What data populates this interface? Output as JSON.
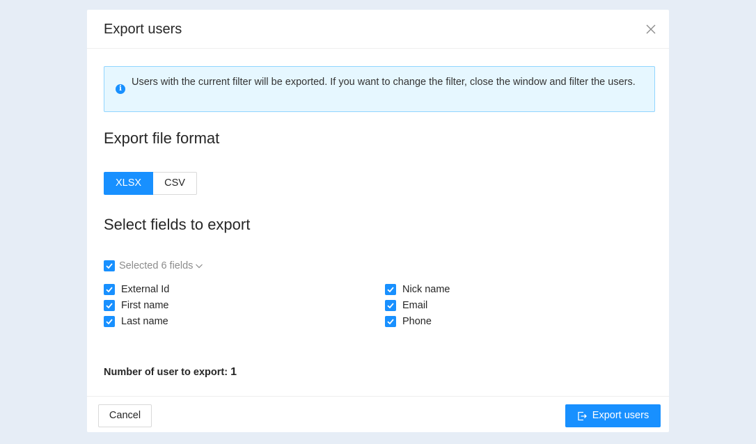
{
  "modal": {
    "title": "Export users",
    "info_text": "Users with the current filter will be exported. If you want to change the filter, close the window and filter the users.",
    "format_section_title": "Export file format",
    "formats": [
      "XLSX",
      "CSV"
    ],
    "selected_format": "XLSX",
    "fields_section_title": "Select fields to export",
    "select_all_label": "Selected 6 fields",
    "fields_left": [
      "External Id",
      "First name",
      "Last name"
    ],
    "fields_right": [
      "Nick name",
      "Email",
      "Phone"
    ],
    "count_label": "Number of user to export:",
    "count_value": "1",
    "cancel_label": "Cancel",
    "export_label": "Export users"
  },
  "colors": {
    "primary": "#1890ff",
    "info_bg": "#e6f7ff",
    "info_border": "#91d5ff",
    "page_bg": "#e6edf6"
  },
  "icons": {
    "close": "close-icon",
    "info": "info-icon",
    "checkbox": "checkmark-icon",
    "chevron": "chevron-down-icon",
    "export": "export-icon"
  }
}
